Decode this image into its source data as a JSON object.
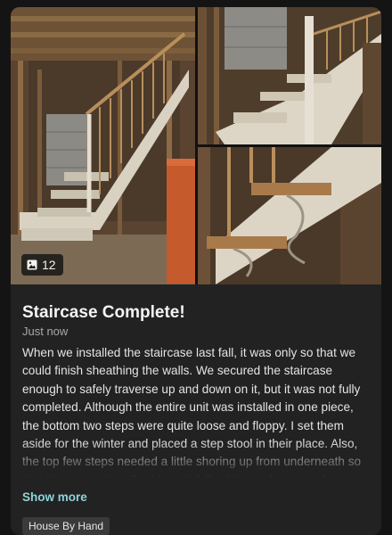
{
  "post": {
    "photo_count": "12",
    "title": "Staircase Complete!",
    "timestamp": "Just now",
    "body": "When we installed the staircase last fall, it was only so that we could finish sheathing the walls. We secured the staircase enough to safely traverse up and down on it, but it was not fully completed. Although the entire unit was installed in one piece, the bottom two steps were quite loose and floppy. I set them aside for the winter and placed a step stool in their place. Also, the top few steps needed a little shoring up from underneath so that they weren't so flexible with full adult weight pressed into them. All of this fixing is",
    "show_more_label": "Show more",
    "tag": "House By Hand"
  },
  "icons": {
    "photo_count": "image-icon"
  },
  "colors": {
    "card_background": "#222222",
    "page_background": "#141414",
    "accent_link": "#8fd3da",
    "tag_background": "#3a3a3a"
  }
}
